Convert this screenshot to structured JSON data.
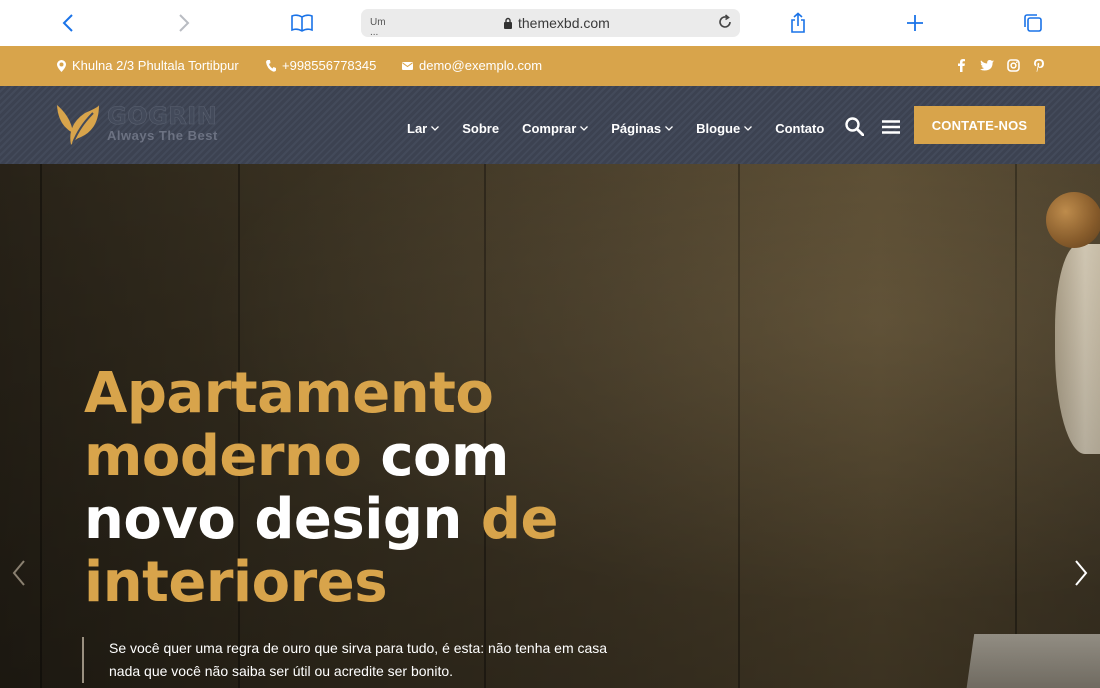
{
  "browser": {
    "address_small_text": "Um ...",
    "url": "themexbd.com"
  },
  "topbar": {
    "address": "Khulna 2/3 Phultala Tortibpur",
    "phone": "+998556778345",
    "email": "demo@exemplo.com",
    "social_icons": [
      "facebook-icon",
      "twitter-icon",
      "instagram-icon",
      "pinterest-icon"
    ],
    "bg_color": "#d8a44b"
  },
  "header": {
    "logo_name": "GOGRIN",
    "logo_tagline": "Always The Best",
    "nav": [
      {
        "label": "Lar",
        "dropdown": true
      },
      {
        "label": "Sobre",
        "dropdown": false
      },
      {
        "label": "Comprar",
        "dropdown": true
      },
      {
        "label": "Páginas",
        "dropdown": true
      },
      {
        "label": "Blogue",
        "dropdown": true
      },
      {
        "label": "Contato",
        "dropdown": false
      }
    ],
    "cta_label": "CONTATE-NOS"
  },
  "hero": {
    "line1_gold": "Apartamento",
    "line2_gold": "moderno",
    "line2_white": "com",
    "line3_white": "novo design",
    "line3_gold": "de",
    "line4_gold": "interiores",
    "subtext": "Se você quer uma regra de ouro que sirva para tudo, é esta: não tenha em casa nada que você não saiba ser útil ou acredite ser bonito.",
    "accent_color": "#d8a44b"
  }
}
